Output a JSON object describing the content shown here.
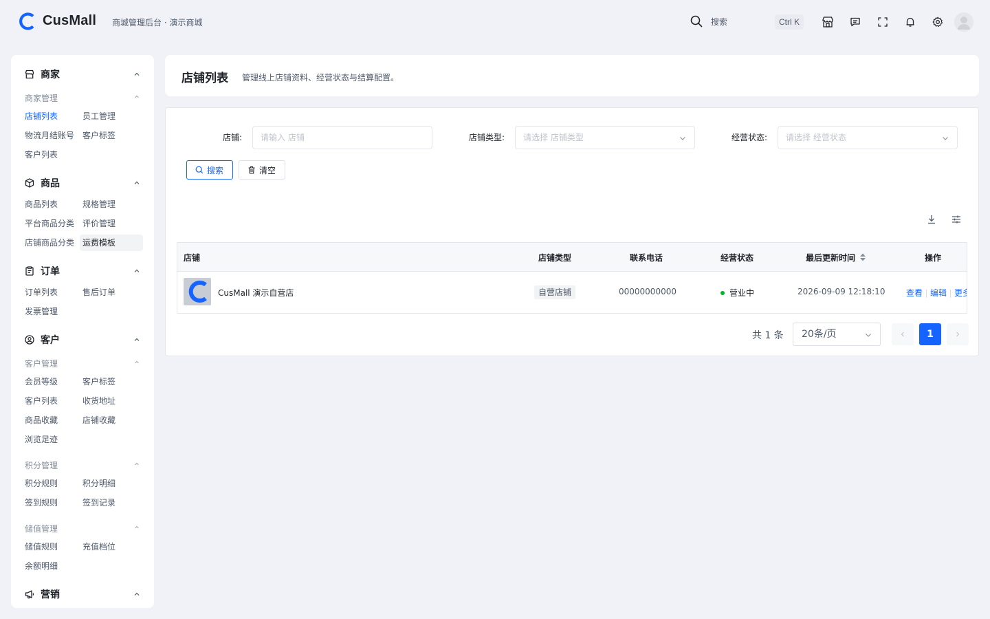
{
  "header": {
    "brand": "CusMall",
    "subtitle": "商城管理后台 · 演示商城",
    "search_label": "搜索",
    "shortcut": "Ctrl K",
    "icons": [
      "search-icon",
      "store-icon",
      "message-icon",
      "fullscreen-icon",
      "bell-icon",
      "gear-icon",
      "avatar"
    ]
  },
  "sidebar": {
    "merchant": {
      "title": "商家",
      "group": "商家管理",
      "items": [
        "店铺列表",
        "员工管理",
        "物流月结账号",
        "客户标签",
        "客户列表"
      ]
    },
    "goods": {
      "title": "商品",
      "items": [
        "商品列表",
        "规格管理",
        "平台商品分类",
        "评价管理",
        "店铺商品分类",
        "运费模板"
      ]
    },
    "orders": {
      "title": "订单",
      "items": [
        "订单列表",
        "售后订单",
        "发票管理"
      ]
    },
    "customers": {
      "title": "客户",
      "group": "客户管理",
      "items": [
        "会员等级",
        "客户标签",
        "客户列表",
        "收货地址",
        "商品收藏",
        "店铺收藏",
        "浏览足迹"
      ],
      "points_group": "积分管理",
      "points_items": [
        "积分规则",
        "积分明细",
        "签到规则",
        "签到记录"
      ],
      "stored_group": "储值管理",
      "stored_items": [
        "储值规则",
        "充值档位",
        "余额明细"
      ]
    },
    "marketing": {
      "title": "营销"
    }
  },
  "page": {
    "title": "店铺列表",
    "description": "管理线上店铺资料、经营状态与结算配置。"
  },
  "filters": {
    "store_label": "店铺:",
    "store_placeholder": "请输入 店铺",
    "type_label": "店铺类型:",
    "type_placeholder": "请选择 店铺类型",
    "status_label": "经营状态:",
    "status_placeholder": "请选择 经营状态",
    "search_button": "搜索",
    "clear_button": "清空"
  },
  "table": {
    "columns": [
      "店铺",
      "店铺类型",
      "联系电话",
      "经营状态",
      "最后更新时间",
      "操作"
    ],
    "rows": [
      {
        "name": "CusMall 演示自营店",
        "type": "自营店铺",
        "phone": "00000000000",
        "status": "营业中",
        "updated": "2026-09-09 12:18:10",
        "actions": [
          "查看",
          "编辑",
          "更多"
        ]
      }
    ]
  },
  "pagination": {
    "total": "共 1 条",
    "page_size": "20条/页",
    "current": "1"
  },
  "colors": {
    "primary": "#1664ff",
    "success": "#00b42a",
    "background": "#f0f2f8"
  }
}
